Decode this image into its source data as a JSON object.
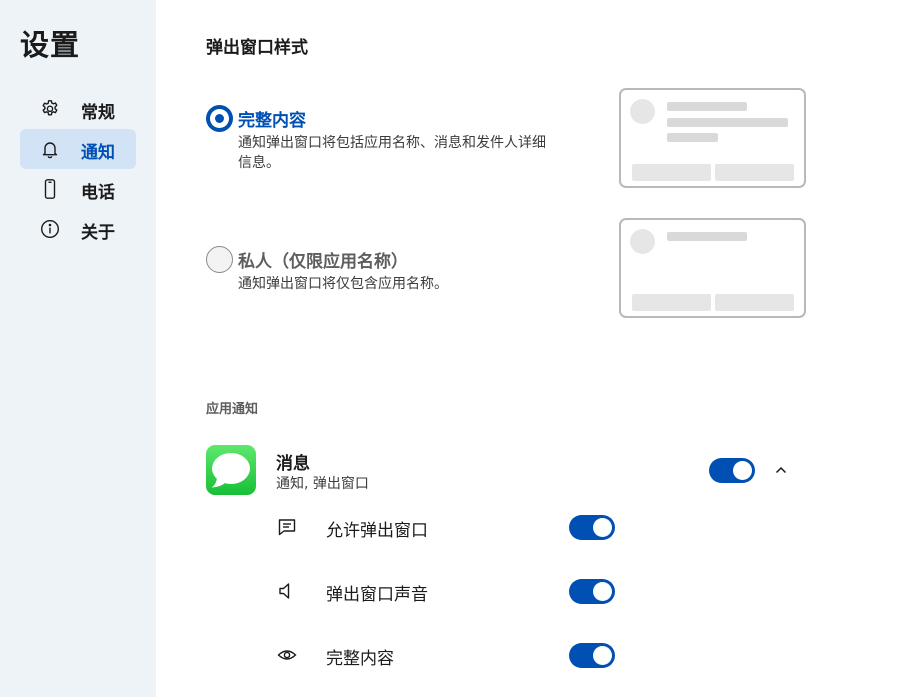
{
  "sidebar": {
    "title": "设置",
    "items": [
      {
        "label": "常规",
        "icon": "gear-icon",
        "active": false
      },
      {
        "label": "通知",
        "icon": "bell-icon",
        "active": true
      },
      {
        "label": "电话",
        "icon": "phone-icon",
        "active": false
      },
      {
        "label": "关于",
        "icon": "info-icon",
        "active": false
      }
    ]
  },
  "popup_style": {
    "title": "弹出窗口样式",
    "options": [
      {
        "label": "完整内容",
        "description": "通知弹出窗口将包括应用名称、消息和发件人详细信息。",
        "selected": true
      },
      {
        "label": "私人（仅限应用名称）",
        "description": "通知弹出窗口将仅包含应用名称。",
        "selected": false
      }
    ]
  },
  "app_notifications": {
    "heading": "应用通知",
    "app": {
      "name": "消息",
      "subtitle": "通知, 弹出窗口",
      "enabled": true,
      "expanded": true,
      "icon": "messages-app-icon"
    },
    "settings": [
      {
        "label": "允许弹出窗口",
        "icon": "message-icon",
        "enabled": true
      },
      {
        "label": "弹出窗口声音",
        "icon": "speaker-icon",
        "enabled": true
      },
      {
        "label": "完整内容",
        "icon": "eye-icon",
        "enabled": true
      }
    ]
  },
  "colors": {
    "accent": "#0050b4",
    "sidebar_bg": "#eef3f8",
    "active_item_bg": "#d3e3f6",
    "messages_green": "#1fc93d"
  }
}
